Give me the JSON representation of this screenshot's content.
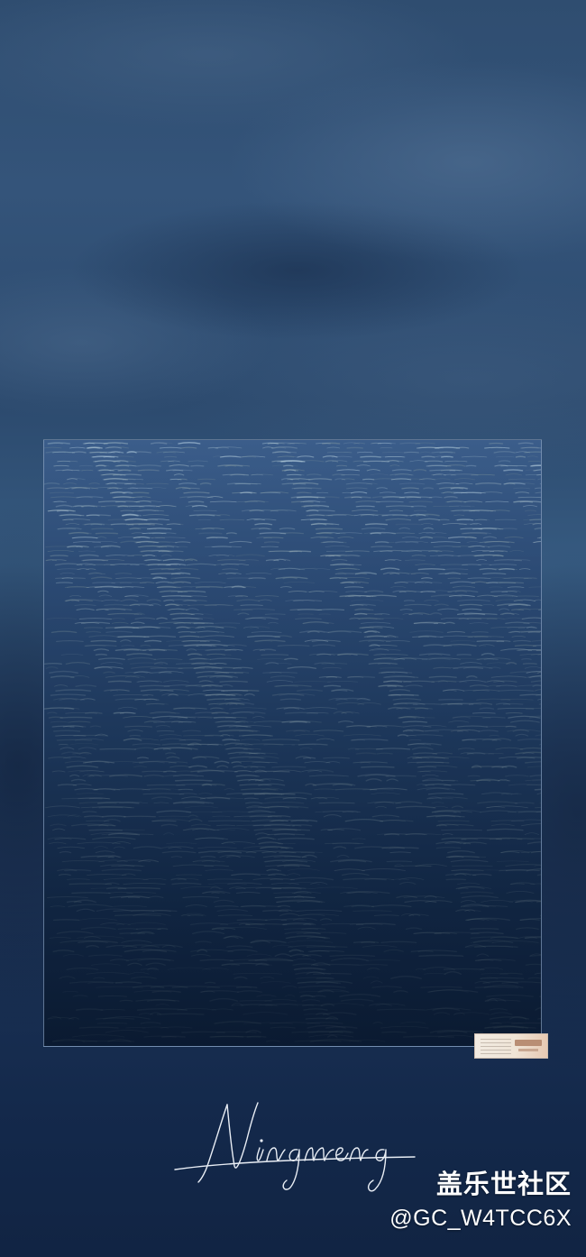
{
  "signature": {
    "text": "Ningmeng"
  },
  "watermark": {
    "brand": "盖乐世社区",
    "handle": "@GC_W4TCC6X"
  },
  "colors": {
    "background": "#2c4a6e",
    "ocean_dark": "#10284b",
    "ocean_light": "#3b5d8a",
    "text": "#ffffff"
  }
}
